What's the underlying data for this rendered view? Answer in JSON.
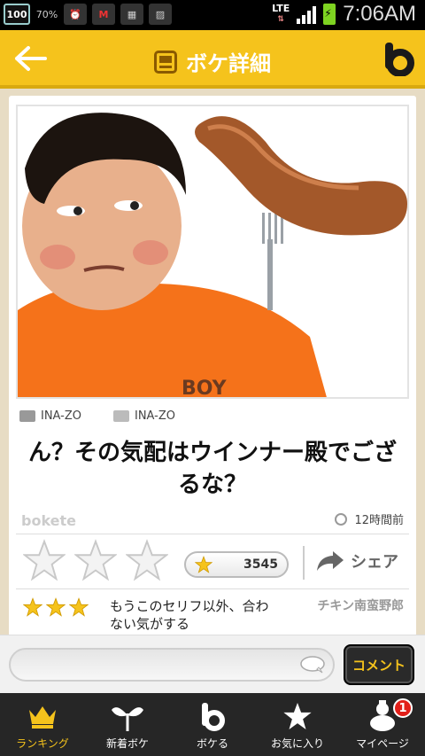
{
  "status_bar": {
    "battery_badge": "100",
    "weather_percent": "70%",
    "network": "LTE",
    "time": "7:06AM",
    "icons": [
      "battery-100-icon",
      "weather-icon",
      "alarm-icon",
      "security-app-icon",
      "gallery-icon",
      "image-icon",
      "signal-icon",
      "battery-charging-icon"
    ]
  },
  "header": {
    "title": "ボケ詳細",
    "back_icon": "back-arrow-icon",
    "logo_icon": "bokete-logo-icon"
  },
  "post": {
    "photo_credit": "INA-ZO",
    "image_credit": "INA-ZO",
    "caption": "ん？その気配はウインナー殿でござるな？",
    "brand": "bokete",
    "posted_ago": "12時間前",
    "rating_stars": 3,
    "star_count": "3545",
    "share_label": "シェア"
  },
  "comment": {
    "stars": 3,
    "text": "もうこのセリフ以外、合わない気がする",
    "user": "チキン南蛮野郎"
  },
  "input": {
    "placeholder": "",
    "button_label": "コメント"
  },
  "nav": {
    "items": [
      {
        "label": "ランキング",
        "icon": "crown-icon"
      },
      {
        "label": "新着ボケ",
        "icon": "sprout-icon"
      },
      {
        "label": "ボケる",
        "icon": "bokete-b-icon"
      },
      {
        "label": "お気に入り",
        "icon": "star-icon"
      },
      {
        "label": "マイページ",
        "icon": "profile-icon",
        "badge": "1"
      }
    ]
  },
  "colors": {
    "brand_yellow": "#f5c31c",
    "nav_bg": "#262626",
    "badge_red": "#e2201a"
  }
}
